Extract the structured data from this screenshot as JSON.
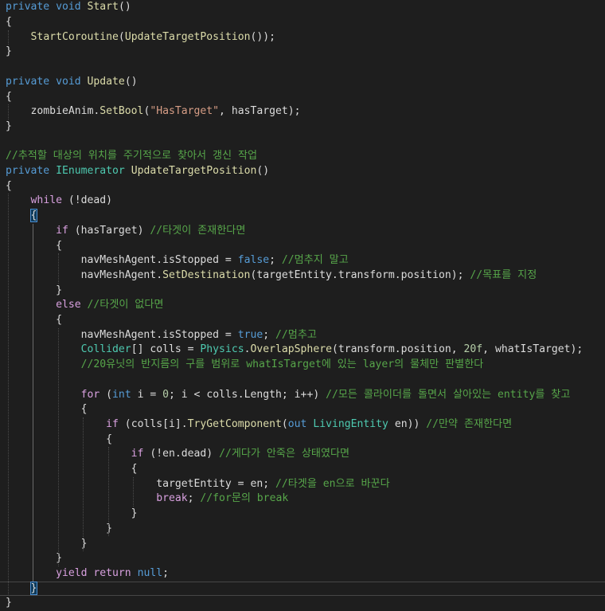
{
  "editor": {
    "theme_colors": {
      "background": "#1e1e1e",
      "keyword": "#569cd6",
      "type": "#4ec9b0",
      "method": "#dcdcaa",
      "string": "#d69d85",
      "number": "#b5cea8",
      "comment": "#57a64a",
      "plain": "#dcdcdc",
      "control": "#d8a0df"
    },
    "lines": [
      [
        [
          "kw",
          "private"
        ],
        [
          "id",
          " "
        ],
        [
          "kw",
          "void"
        ],
        [
          "id",
          " "
        ],
        [
          "fn",
          "Start"
        ],
        [
          "id",
          "()"
        ]
      ],
      [
        [
          "id",
          "{"
        ]
      ],
      [
        [
          "id",
          "    "
        ],
        [
          "fn",
          "StartCoroutine"
        ],
        [
          "id",
          "("
        ],
        [
          "fn",
          "UpdateTargetPosition"
        ],
        [
          "id",
          "());"
        ]
      ],
      [
        [
          "id",
          "}"
        ]
      ],
      [],
      [
        [
          "kw",
          "private"
        ],
        [
          "id",
          " "
        ],
        [
          "kw",
          "void"
        ],
        [
          "id",
          " "
        ],
        [
          "fn",
          "Update"
        ],
        [
          "id",
          "()"
        ]
      ],
      [
        [
          "id",
          "{"
        ]
      ],
      [
        [
          "id",
          "    zombieAnim."
        ],
        [
          "fn",
          "SetBool"
        ],
        [
          "id",
          "("
        ],
        [
          "str",
          "\"HasTarget\""
        ],
        [
          "id",
          ", hasTarget);"
        ]
      ],
      [
        [
          "id",
          "}"
        ]
      ],
      [],
      [
        [
          "cm",
          "//추적할 대상의 위치를 주기적으로 찾아서 갱신 작업"
        ]
      ],
      [
        [
          "kw",
          "private"
        ],
        [
          "id",
          " "
        ],
        [
          "ty",
          "IEnumerator"
        ],
        [
          "id",
          " "
        ],
        [
          "fn",
          "UpdateTargetPosition"
        ],
        [
          "id",
          "()"
        ]
      ],
      [
        [
          "id",
          "{"
        ]
      ],
      [
        [
          "id",
          "    "
        ],
        [
          "cw",
          "while"
        ],
        [
          "id",
          " (!dead)"
        ]
      ],
      [
        [
          "id",
          "    "
        ],
        [
          "bl",
          "{"
        ]
      ],
      [
        [
          "id",
          "        "
        ],
        [
          "cw",
          "if"
        ],
        [
          "id",
          " (hasTarget) "
        ],
        [
          "cm",
          "//타겟이 존재한다면"
        ]
      ],
      [
        [
          "id",
          "        {"
        ]
      ],
      [
        [
          "id",
          "            navMeshAgent.isStopped = "
        ],
        [
          "kw",
          "false"
        ],
        [
          "id",
          "; "
        ],
        [
          "cm",
          "//멈추지 말고"
        ]
      ],
      [
        [
          "id",
          "            navMeshAgent."
        ],
        [
          "fn",
          "SetDestination"
        ],
        [
          "id",
          "(targetEntity.transform.position); "
        ],
        [
          "cm",
          "//목표를 지정"
        ]
      ],
      [
        [
          "id",
          "        }"
        ]
      ],
      [
        [
          "id",
          "        "
        ],
        [
          "cw",
          "else"
        ],
        [
          "id",
          " "
        ],
        [
          "cm",
          "//타겟이 없다면"
        ]
      ],
      [
        [
          "id",
          "        {"
        ]
      ],
      [
        [
          "id",
          "            navMeshAgent.isStopped = "
        ],
        [
          "kw",
          "true"
        ],
        [
          "id",
          "; "
        ],
        [
          "cm",
          "//멈추고"
        ]
      ],
      [
        [
          "id",
          "            "
        ],
        [
          "ty",
          "Collider"
        ],
        [
          "id",
          "[] colls = "
        ],
        [
          "ty",
          "Physics"
        ],
        [
          "id",
          "."
        ],
        [
          "fn",
          "OverlapSphere"
        ],
        [
          "id",
          "(transform.position, "
        ],
        [
          "num",
          "20f"
        ],
        [
          "id",
          ", whatIsTarget);"
        ]
      ],
      [
        [
          "id",
          "            "
        ],
        [
          "cm",
          "//20유닛의 반지름의 구를 범위로 whatIsTarget에 있는 layer의 물체만 판별한다"
        ]
      ],
      [],
      [
        [
          "id",
          "            "
        ],
        [
          "cw",
          "for"
        ],
        [
          "id",
          " ("
        ],
        [
          "kw",
          "int"
        ],
        [
          "id",
          " i = "
        ],
        [
          "num",
          "0"
        ],
        [
          "id",
          "; i < colls.Length; i++) "
        ],
        [
          "cm",
          "//모든 콜라이더를 돌면서 살아있는 entity를 찾고"
        ]
      ],
      [
        [
          "id",
          "            {"
        ]
      ],
      [
        [
          "id",
          "                "
        ],
        [
          "cw",
          "if"
        ],
        [
          "id",
          " (colls[i]."
        ],
        [
          "fn",
          "TryGetComponent"
        ],
        [
          "id",
          "("
        ],
        [
          "kw",
          "out"
        ],
        [
          "id",
          " "
        ],
        [
          "ty",
          "LivingEntity"
        ],
        [
          "id",
          " en)) "
        ],
        [
          "cm",
          "//만약 존재한다면"
        ]
      ],
      [
        [
          "id",
          "                {"
        ]
      ],
      [
        [
          "id",
          "                    "
        ],
        [
          "cw",
          "if"
        ],
        [
          "id",
          " (!en.dead) "
        ],
        [
          "cm",
          "//게다가 안죽은 상태였다면"
        ]
      ],
      [
        [
          "id",
          "                    {"
        ]
      ],
      [
        [
          "id",
          "                        targetEntity = en; "
        ],
        [
          "cm",
          "//타겟을 en으로 바꾼다"
        ]
      ],
      [
        [
          "id",
          "                        "
        ],
        [
          "cw",
          "break"
        ],
        [
          "id",
          "; "
        ],
        [
          "cm",
          "//for문의 break"
        ]
      ],
      [
        [
          "id",
          "                    }"
        ]
      ],
      [
        [
          "id",
          "                }"
        ]
      ],
      [
        [
          "id",
          "            }"
        ]
      ],
      [
        [
          "id",
          "        }"
        ]
      ],
      [
        [
          "id",
          "        "
        ],
        [
          "cw",
          "yield"
        ],
        [
          "id",
          " "
        ],
        [
          "cw",
          "return"
        ],
        [
          "id",
          " "
        ],
        [
          "kw",
          "null"
        ],
        [
          "id",
          ";"
        ]
      ],
      [
        [
          "id",
          "    "
        ],
        [
          "bl",
          "}"
        ]
      ],
      [
        [
          "id",
          "}"
        ]
      ]
    ],
    "current_line_index": 39,
    "highlighted_brace_lines": [
      14,
      39
    ]
  }
}
